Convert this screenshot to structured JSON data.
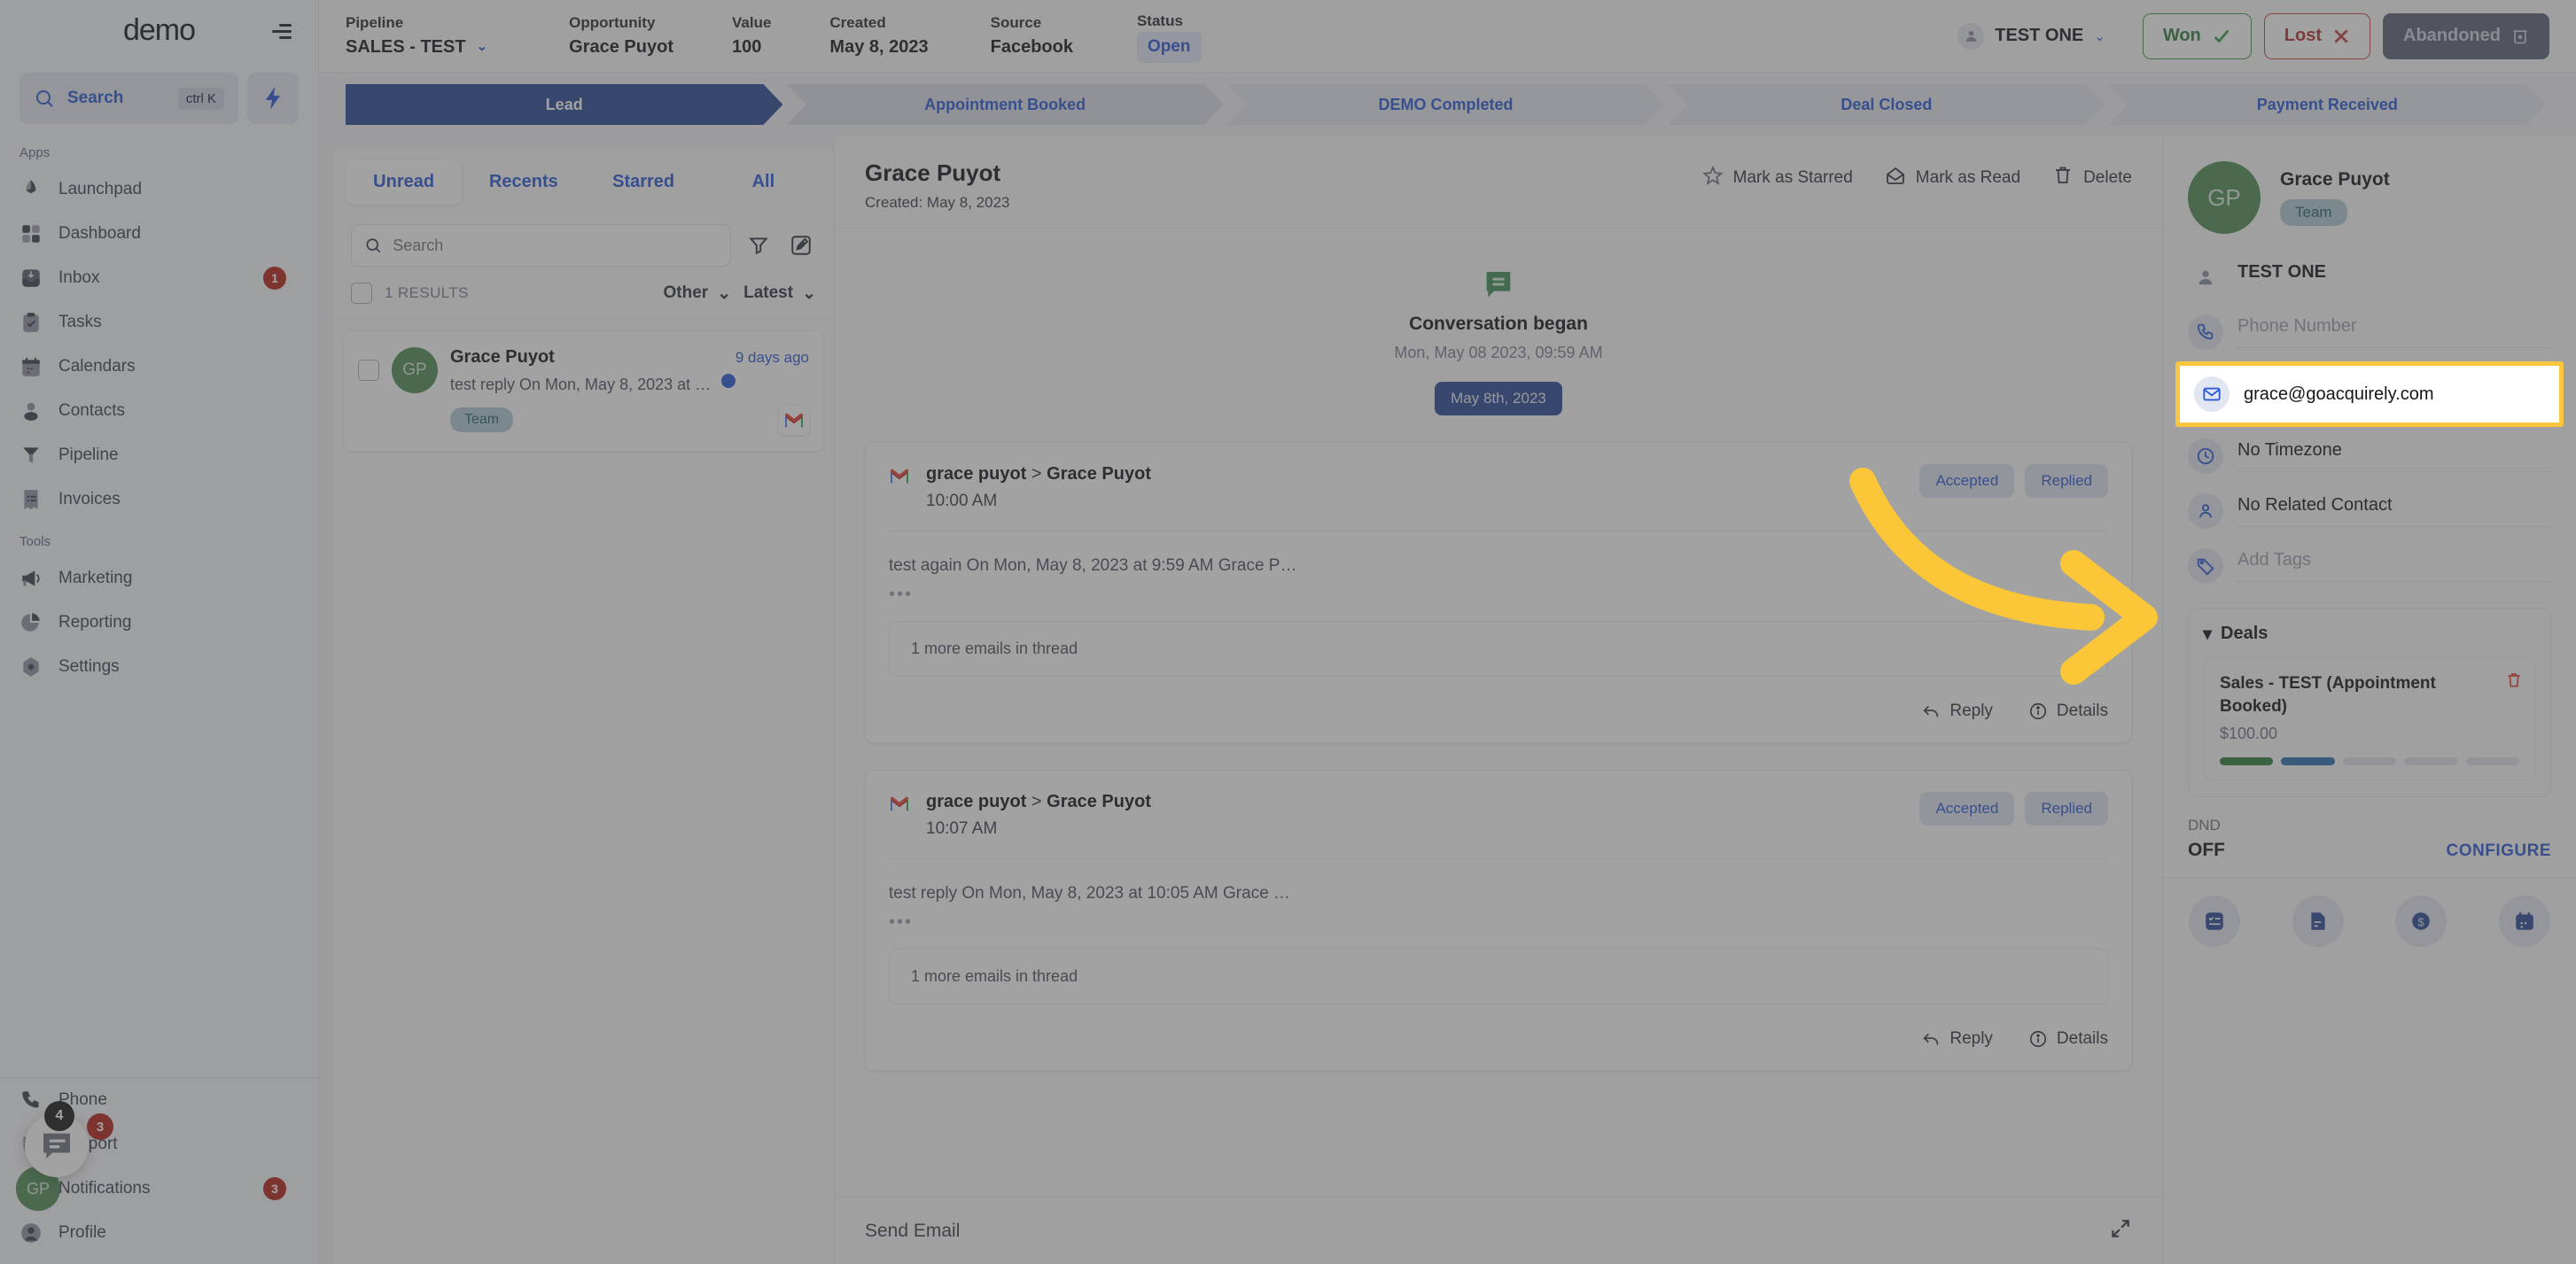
{
  "sidebar": {
    "brand": "demo",
    "search": {
      "label": "Search",
      "shortcut": "ctrl K"
    },
    "section_apps": "Apps",
    "section_tools": "Tools",
    "apps": [
      {
        "label": "Launchpad",
        "icon": "launchpad-icon",
        "badge": ""
      },
      {
        "label": "Dashboard",
        "icon": "dashboard-icon",
        "badge": ""
      },
      {
        "label": "Inbox",
        "icon": "inbox-icon",
        "badge": "1"
      },
      {
        "label": "Tasks",
        "icon": "tasks-icon",
        "badge": ""
      },
      {
        "label": "Calendars",
        "icon": "calendar-icon",
        "badge": ""
      },
      {
        "label": "Contacts",
        "icon": "contacts-icon",
        "badge": ""
      },
      {
        "label": "Pipeline",
        "icon": "pipeline-icon",
        "badge": ""
      },
      {
        "label": "Invoices",
        "icon": "invoices-icon",
        "badge": ""
      }
    ],
    "tools": [
      {
        "label": "Marketing",
        "icon": "megaphone-icon",
        "badge": ""
      },
      {
        "label": "Reporting",
        "icon": "piechart-icon",
        "badge": ""
      },
      {
        "label": "Settings",
        "icon": "gear-icon",
        "badge": ""
      }
    ],
    "bottom": [
      {
        "label": "Phone",
        "icon": "phone-icon",
        "badge": ""
      },
      {
        "label": "Support",
        "icon": "support-chat-icon",
        "badge": ""
      },
      {
        "label": "Notifications",
        "icon": "bell-icon",
        "badge": "3"
      },
      {
        "label": "Profile",
        "icon": "avatar-icon",
        "badge": ""
      }
    ],
    "profile_initials": "GP",
    "chat_badge_dark": "4",
    "chat_badge_red": "3"
  },
  "opportunity_bar": {
    "fields": [
      {
        "key": "Pipeline",
        "value": "SALES - TEST",
        "has_caret": true
      },
      {
        "key": "Opportunity",
        "value": "Grace Puyot",
        "has_caret": false
      },
      {
        "key": "Value",
        "value": "100",
        "has_caret": false
      },
      {
        "key": "Created",
        "value": "May 8, 2023",
        "has_caret": false
      },
      {
        "key": "Source",
        "value": "Facebook",
        "has_caret": false
      }
    ],
    "status_key": "Status",
    "status_value": "Open",
    "assignee": "TEST ONE",
    "won_label": "Won",
    "lost_label": "Lost",
    "abandoned_label": "Abandoned"
  },
  "stages": [
    {
      "label": "Lead",
      "state": "active"
    },
    {
      "label": "Appointment Booked",
      "state": "next"
    },
    {
      "label": "DEMO Completed",
      "state": "default"
    },
    {
      "label": "Deal Closed",
      "state": "default"
    },
    {
      "label": "Payment Received",
      "state": "default"
    }
  ],
  "conversation_list": {
    "tabs": [
      {
        "label": "Unread",
        "active": true
      },
      {
        "label": "Recents",
        "active": false
      },
      {
        "label": "Starred",
        "active": false
      },
      {
        "label": "All",
        "active": false
      }
    ],
    "search_placeholder": "Search",
    "results_count": "1 RESULTS",
    "filter_select": "Other",
    "sort_select": "Latest",
    "items": [
      {
        "initials": "GP",
        "name": "Grace Puyot",
        "time": "9 days ago",
        "snippet": "test reply On Mon, May 8, 2023 at …",
        "tag": "Team",
        "channel": "gmail-icon",
        "unread": true
      }
    ]
  },
  "thread": {
    "title": "Grace Puyot",
    "created": "Created: May 8, 2023",
    "actions": [
      {
        "label": "Mark as Starred",
        "icon": "star-icon"
      },
      {
        "label": "Mark as Read",
        "icon": "open-envelope-icon"
      },
      {
        "label": "Delete",
        "icon": "trash-icon"
      }
    ],
    "began_title": "Conversation began",
    "began_sub": "Mon, May 08 2023, 09:59 AM",
    "date_chip": "May 8th, 2023",
    "emails": [
      {
        "from": "grace puyot",
        "arrow": ">",
        "to": "Grace Puyot",
        "time": "10:00 AM",
        "chips": [
          "Accepted",
          "Replied"
        ],
        "body": "test again On Mon, May 8, 2023 at 9:59 AM Grace P…",
        "dots": "•••",
        "more": "1 more emails in thread",
        "reply_label": "Reply",
        "details_label": "Details"
      },
      {
        "from": "grace puyot",
        "arrow": ">",
        "to": "Grace Puyot",
        "time": "10:07 AM",
        "chips": [
          "Accepted",
          "Replied"
        ],
        "body": "test reply On Mon, May 8, 2023 at 10:05 AM Grace …",
        "dots": "•••",
        "more": "1 more emails in thread",
        "reply_label": "Reply",
        "details_label": "Details"
      }
    ],
    "composer_placeholder": "Send Email"
  },
  "detail": {
    "initials": "GP",
    "name": "Grace Puyot",
    "tag": "Team",
    "owner": "TEST ONE",
    "phone_placeholder": "Phone Number",
    "email": "grace@goacquirely.com",
    "timezone": "No Timezone",
    "related_contact": "No Related Contact",
    "tags_placeholder": "Add Tags",
    "deals_title": "Deals",
    "deal": {
      "name": "Sales - TEST (Appointment Booked)",
      "amount": "$100.00",
      "progress_filled": 2,
      "progress_total": 5
    },
    "dnd_label": "DND",
    "dnd_value": "OFF",
    "configure_label": "CONFIGURE",
    "quick_actions": [
      {
        "icon": "tasks-square-icon"
      },
      {
        "icon": "notes-doc-icon"
      },
      {
        "icon": "dollar-icon"
      },
      {
        "icon": "calendar-square-icon"
      }
    ]
  },
  "annotation": {
    "arrow_color": "#fbc738",
    "highlight_color": "#fcc73f",
    "target": "email-field"
  }
}
